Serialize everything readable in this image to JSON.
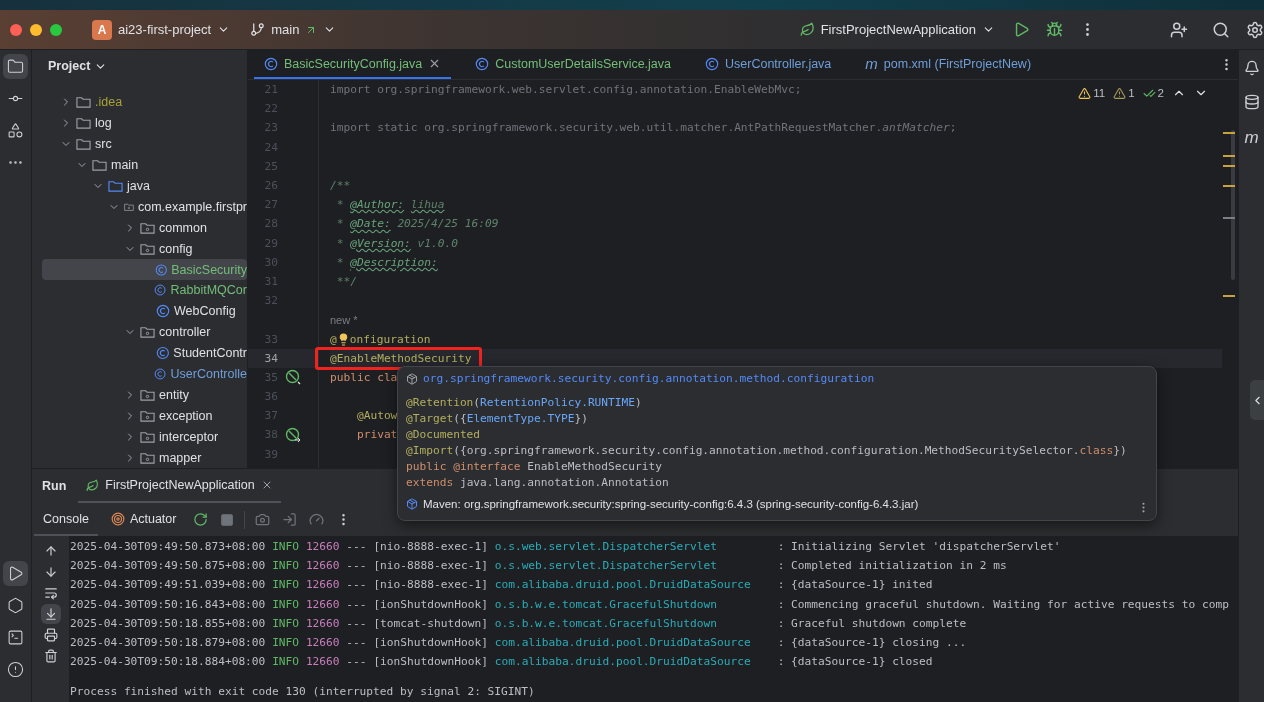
{
  "title_bar": {
    "project_badge": "A",
    "project": "ai23-first-project",
    "branch": "main",
    "run_config": "FirstProjectNewApplication"
  },
  "left_stripe": {
    "top": [
      {
        "kind": "project",
        "selected": true
      },
      {
        "kind": "commit",
        "selected": false
      },
      {
        "kind": "structure",
        "selected": false
      },
      {
        "kind": "more",
        "selected": false
      }
    ],
    "bottom": [
      {
        "kind": "run",
        "selected": true
      },
      {
        "kind": "services",
        "selected": false
      },
      {
        "kind": "terminal",
        "selected": false
      },
      {
        "kind": "problems",
        "selected": false
      }
    ]
  },
  "project": {
    "title": "Project",
    "tree": [
      {
        "label": ".idea",
        "kind": "folder",
        "expanded": false,
        "selected": false,
        "color": "#a8a23a"
      },
      {
        "label": "log",
        "kind": "folder",
        "expanded": false,
        "selected": false,
        "color": "#dfe1e5"
      },
      {
        "label": "src",
        "kind": "folder",
        "expanded": true,
        "selected": false,
        "color": "#dfe1e5",
        "children": [
          {
            "label": "main",
            "kind": "folder",
            "expanded": true,
            "selected": false,
            "color": "#dfe1e5",
            "children": [
              {
                "label": "java",
                "kind": "source",
                "expanded": true,
                "selected": false,
                "color": "#dfe1e5",
                "children": [
                  {
                    "label": "com.example.firstpr",
                    "kind": "package",
                    "expanded": true,
                    "selected": false,
                    "color": "#dfe1e5",
                    "children": [
                      {
                        "label": "common",
                        "kind": "package",
                        "expanded": false,
                        "selected": false,
                        "color": "#dfe1e5"
                      },
                      {
                        "label": "config",
                        "kind": "package",
                        "expanded": true,
                        "selected": false,
                        "color": "#dfe1e5",
                        "children": [
                          {
                            "label": "BasicSecurity",
                            "kind": "class",
                            "selected": true,
                            "color": "#73bd79"
                          },
                          {
                            "label": "RabbitMQCor",
                            "kind": "class",
                            "selected": false,
                            "color": "#73bd79"
                          },
                          {
                            "label": "WebConfig",
                            "kind": "class",
                            "selected": false,
                            "color": "#dfe1e5"
                          }
                        ]
                      },
                      {
                        "label": "controller",
                        "kind": "package",
                        "expanded": true,
                        "selected": false,
                        "color": "#dfe1e5",
                        "children": [
                          {
                            "label": "StudentContr",
                            "kind": "class",
                            "selected": false,
                            "color": "#dfe1e5"
                          },
                          {
                            "label": "UserControlle",
                            "kind": "class",
                            "selected": false,
                            "color": "#6f9ed9"
                          }
                        ]
                      },
                      {
                        "label": "entity",
                        "kind": "package",
                        "expanded": false,
                        "selected": false,
                        "color": "#dfe1e5"
                      },
                      {
                        "label": "exception",
                        "kind": "package",
                        "expanded": false,
                        "selected": false,
                        "color": "#dfe1e5"
                      },
                      {
                        "label": "interceptor",
                        "kind": "package",
                        "expanded": false,
                        "selected": false,
                        "color": "#dfe1e5"
                      },
                      {
                        "label": "mapper",
                        "kind": "package",
                        "expanded": false,
                        "selected": false,
                        "color": "#dfe1e5"
                      }
                    ]
                  }
                ]
              }
            ]
          }
        ]
      }
    ]
  },
  "editor": {
    "tabs": [
      {
        "label": "BasicSecurityConfig.java",
        "kind": "class",
        "selected": true,
        "color": "#73bd79"
      },
      {
        "label": "CustomUserDetailsService.java",
        "kind": "class",
        "selected": false,
        "color": "#73bd79"
      },
      {
        "label": "UserController.java",
        "kind": "class",
        "selected": false,
        "color": "#6f9ed9"
      },
      {
        "label": "pom.xml (FirstProjectNew)",
        "kind": "maven",
        "glyph": "m",
        "selected": false,
        "color": "#6f9ed9"
      }
    ],
    "inspections": {
      "warnings": "11",
      "weak_warnings": "1",
      "typos": "2"
    },
    "lines": [
      {
        "number": "21",
        "tokens": [
          {
            "text": "import org.springframework.web.servlet.config.annotation.EnableWebMvc;",
            "kind": "unused"
          }
        ]
      },
      {
        "number": "22"
      },
      {
        "number": "23",
        "tokens": [
          {
            "text": "import static org.springframework.security.web.util.matcher.AntPathRequestMatcher.",
            "kind": "unused"
          },
          {
            "text": "antMatcher",
            "kind": "unused-italic"
          },
          {
            "text": ";",
            "kind": "unused"
          }
        ]
      },
      {
        "number": "24"
      },
      {
        "number": "25"
      },
      {
        "number": "26",
        "tokens": [
          {
            "text": "/**",
            "kind": "comment"
          }
        ]
      },
      {
        "number": "27",
        "tokens": [
          {
            "text": " * ",
            "kind": "comment"
          },
          {
            "text": "@Author:",
            "kind": "doctag"
          },
          {
            "text": "lihua",
            "kind": "typo"
          }
        ]
      },
      {
        "number": "28",
        "tokens": [
          {
            "text": " * ",
            "kind": "comment"
          },
          {
            "text": "@Date:",
            "kind": "doctag"
          },
          {
            "text": " 2025/4/25 16:09",
            "kind": "comment"
          }
        ]
      },
      {
        "number": "29",
        "tokens": [
          {
            "text": " * ",
            "kind": "comment"
          },
          {
            "text": "@Version:",
            "kind": "doctag"
          },
          {
            "text": " v1.0.0",
            "kind": "comment"
          }
        ]
      },
      {
        "number": "30",
        "tokens": [
          {
            "text": " * ",
            "kind": "comment"
          },
          {
            "text": "@Description:",
            "kind": "doctag"
          }
        ]
      },
      {
        "number": "31",
        "tokens": [
          {
            "text": " **/",
            "kind": "comment"
          }
        ]
      },
      {
        "number": "32"
      },
      {
        "inlay": "new *"
      },
      {
        "number": "33",
        "tokens": [
          {
            "text": "@",
            "kind": "annotation"
          },
          {
            "kind": "bulb"
          },
          {
            "text": "onfiguration",
            "kind": "annotation"
          }
        ]
      },
      {
        "number": "34",
        "current": true,
        "framed": true,
        "tokens": [
          {
            "text": "@EnableMethodSecurity",
            "kind": "annotation"
          }
        ]
      },
      {
        "number": "35",
        "gutter": {
          "kind": "bean"
        },
        "tokens": [
          {
            "text": "public cla",
            "kind": "keyword"
          }
        ]
      },
      {
        "number": "36"
      },
      {
        "number": "37",
        "tokens": [
          {
            "text": "    @Autow",
            "kind": "annotation"
          }
        ]
      },
      {
        "number": "38",
        "gutter": {
          "kind": "bean-link"
        },
        "tokens": [
          {
            "text": "    privat",
            "kind": "keyword"
          }
        ]
      },
      {
        "number": "39"
      }
    ]
  },
  "popup": {
    "package": "org.springframework.security.config.annotation.method.configuration",
    "lines": [
      [
        {
          "text": "@Retention",
          "kind": "annotation"
        },
        {
          "text": "(",
          "kind": "plain"
        },
        {
          "text": "RetentionPolicy.RUNTIME",
          "kind": "ref"
        },
        {
          "text": ")",
          "kind": "plain"
        }
      ],
      [
        {
          "text": "@Target",
          "kind": "annotation"
        },
        {
          "text": "({",
          "kind": "plain"
        },
        {
          "text": "ElementType.TYPE",
          "kind": "ref"
        },
        {
          "text": "})",
          "kind": "plain"
        }
      ],
      [
        {
          "text": "@Documented",
          "kind": "annotation"
        }
      ],
      [
        {
          "text": "@Import",
          "kind": "annotation"
        },
        {
          "text": "({org.springframework.security.config.annotation.method.configuration.MethodSecuritySelector.",
          "kind": "plain"
        },
        {
          "text": "class",
          "kind": "keyword"
        },
        {
          "text": "})",
          "kind": "plain"
        }
      ],
      [
        {
          "text": "public ",
          "kind": "keyword"
        },
        {
          "text": "@interface ",
          "kind": "keyword"
        },
        {
          "text": "EnableMethodSecurity",
          "kind": "plain"
        }
      ],
      [
        {
          "text": "extends ",
          "kind": "keyword"
        },
        {
          "text": "java.lang.annotation.Annotation",
          "kind": "plain"
        }
      ]
    ],
    "source": "Maven: org.springframework.security:spring-security-config:6.4.3 (spring-security-config-6.4.3.jar)"
  },
  "run": {
    "title": "Run",
    "tabs": [
      {
        "label": "FirstProjectNewApplication",
        "selected": true
      }
    ],
    "views": [
      {
        "label": "Console",
        "kind": "console",
        "selected": true
      },
      {
        "label": "Actuator",
        "kind": "actuator",
        "selected": false
      }
    ],
    "side_tools": [
      {
        "kind": "up",
        "selected": false
      },
      {
        "kind": "down",
        "selected": false
      },
      {
        "kind": "wrap",
        "selected": false
      },
      {
        "kind": "scroll-end",
        "selected": true
      },
      {
        "kind": "print",
        "selected": false
      },
      {
        "kind": "clear",
        "selected": false
      }
    ],
    "log": [
      {
        "time": "2025-04-30T09:49:50.873+08:00",
        "level": "INFO",
        "pid": "12660",
        "sep": "---",
        "thread": "[nio-8888-exec-1]",
        "logger": "o.s.web.servlet.DispatcherServlet",
        "message": ": Initializing Servlet 'dispatcherServlet'"
      },
      {
        "time": "2025-04-30T09:49:50.875+08:00",
        "level": "INFO",
        "pid": "12660",
        "sep": "---",
        "thread": "[nio-8888-exec-1]",
        "logger": "o.s.web.servlet.DispatcherServlet",
        "message": ": Completed initialization in 2 ms"
      },
      {
        "time": "2025-04-30T09:49:51.039+08:00",
        "level": "INFO",
        "pid": "12660",
        "sep": "---",
        "thread": "[nio-8888-exec-1]",
        "logger": "com.alibaba.druid.pool.DruidDataSource",
        "message": ": {dataSource-1} inited"
      },
      {
        "time": "2025-04-30T09:50:16.843+08:00",
        "level": "INFO",
        "pid": "12660",
        "sep": "---",
        "thread": "[ionShutdownHook]",
        "logger": "o.s.b.w.e.tomcat.GracefulShutdown",
        "message": ": Commencing graceful shutdown. Waiting for active requests to comp"
      },
      {
        "time": "2025-04-30T09:50:18.855+08:00",
        "level": "INFO",
        "pid": "12660",
        "sep": "---",
        "thread": "[tomcat-shutdown]",
        "logger": "o.s.b.w.e.tomcat.GracefulShutdown",
        "message": ": Graceful shutdown complete"
      },
      {
        "time": "2025-04-30T09:50:18.879+08:00",
        "level": "INFO",
        "pid": "12660",
        "sep": "---",
        "thread": "[ionShutdownHook]",
        "logger": "com.alibaba.druid.pool.DruidDataSource",
        "message": ": {dataSource-1} closing ..."
      },
      {
        "time": "2025-04-30T09:50:18.884+08:00",
        "level": "INFO",
        "pid": "12660",
        "sep": "---",
        "thread": "[ionShutdownHook]",
        "logger": "com.alibaba.druid.pool.DruidDataSource",
        "message": ": {dataSource-1} closed"
      }
    ],
    "exit_message": "Process finished with exit code 130 (interrupted by signal 2: SIGINT)"
  },
  "right_stripe": {
    "items": [
      {
        "kind": "notifications",
        "selected": false
      },
      {
        "kind": "database",
        "selected": false
      },
      {
        "kind": "maven",
        "glyph": "m",
        "selected": false
      }
    ]
  }
}
